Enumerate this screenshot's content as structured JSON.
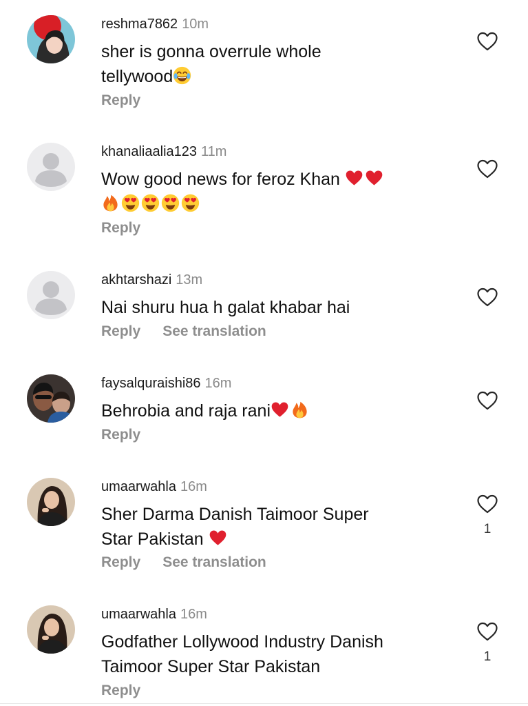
{
  "comments": [
    {
      "username": "reshma7862",
      "time": "10m",
      "text_lines": [
        "sher is gonna overrule whole",
        "tellywood"
      ],
      "reply": "Reply",
      "translate": "",
      "likes": ""
    },
    {
      "username": "khanaliaalia123",
      "time": "11m",
      "text_lines": [
        "Wow good news for feroz Khan"
      ],
      "reply": "Reply",
      "translate": "",
      "likes": ""
    },
    {
      "username": "akhtarshazi",
      "time": "13m",
      "text_lines": [
        "Nai shuru hua h galat khabar hai"
      ],
      "reply": "Reply",
      "translate": "See translation",
      "likes": ""
    },
    {
      "username": "faysalquraishi86",
      "time": "16m",
      "text_lines": [
        "Behrobia and raja  rani"
      ],
      "reply": "Reply",
      "translate": "",
      "likes": ""
    },
    {
      "username": "umaarwahla",
      "time": "16m",
      "text_lines": [
        "Sher Darma  Danish Taimoor Super",
        "Star Pakistan "
      ],
      "reply": "Reply",
      "translate": "See translation",
      "likes": "1"
    },
    {
      "username": "umaarwahla",
      "time": "16m",
      "text_lines": [
        "Godfather Lollywood Industry Danish",
        "Taimoor Super Star Pakistan"
      ],
      "reply": "Reply",
      "translate": "",
      "likes": "1"
    }
  ],
  "icons": {
    "like": "heart-outline-icon",
    "default_avatar": "person-silhouette-icon",
    "emoji_laugh": "tears-of-joy-emoji",
    "emoji_heart": "red-heart-emoji",
    "emoji_fire": "fire-emoji",
    "emoji_love": "heart-eyes-emoji"
  },
  "colors": {
    "username": "#1a1a1a",
    "meta_gray": "#8a8a8a",
    "action_gray": "#8e8e8e",
    "default_avatar_bg": "#e9e9eb",
    "default_avatar_fg": "#c7c7cc"
  }
}
